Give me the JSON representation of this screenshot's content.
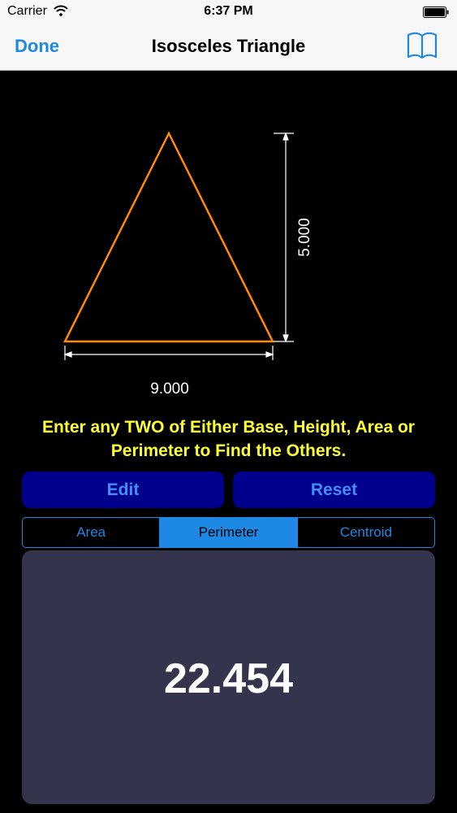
{
  "status_bar": {
    "carrier": "Carrier",
    "time": "6:37 PM",
    "icons": [
      "wifi-icon",
      "battery-icon"
    ]
  },
  "nav": {
    "done_label": "Done",
    "title": "Isosceles Triangle",
    "right_icon": "book-icon"
  },
  "diagram": {
    "base_label": "9.000",
    "height_label": "5.000",
    "triangle_color": "#ff8c00"
  },
  "instructions": "Enter any TWO of Either Base, Height, Area or Perimeter to Find the Others.",
  "buttons": {
    "edit_label": "Edit",
    "reset_label": "Reset"
  },
  "tabs": [
    {
      "label": "Area",
      "selected": false
    },
    {
      "label": "Perimeter",
      "selected": true
    },
    {
      "label": "Centroid",
      "selected": false
    }
  ],
  "result": {
    "value": "22.454"
  },
  "colors": {
    "accent": "#1e88e5",
    "instruction_text": "#ffff33",
    "button_bg": "#00008c",
    "panel_bg": "#34344d"
  }
}
